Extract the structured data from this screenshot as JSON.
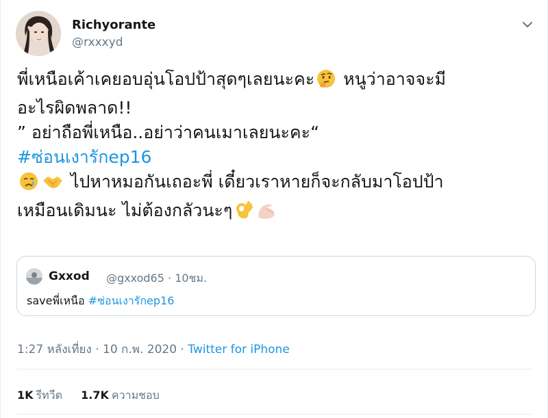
{
  "tweet": {
    "author": {
      "display_name": "Richyorante",
      "handle": "@rxxxyd",
      "avatar_icon": "user-avatar-photo"
    },
    "menu_icon": "chevron-down-icon",
    "lines": [
      {
        "text": "พี่เหนือเค้าเคยอบอุ่นโอปป้าสุดๆเลยนะคะ",
        "emoji": "thinking-face-emoji",
        "after": " หนูว่าอาจจะมี"
      },
      {
        "text": "อะไรผิดพลาด!!"
      },
      {
        "text": "” อย่าถือพี่เหนือ..อย่าว่าคนเมาเลยนะคะ“"
      },
      {
        "hashtag": "#ซ่อนเงารักep16"
      },
      {
        "text": " ไปหาหมอกันเถอะพี่ เดี๋ยวเราหายก็จะกลับมาโอปป้า"
      },
      {
        "text": "เหมือนเดิมนะ ไม่ต้องกลัวนะๆ"
      }
    ],
    "emojis": {
      "thinking": "thinking-face-emoji",
      "crying": "crying-face-emoji",
      "handshake": "handshake-emoji",
      "ok_hand": "ok-hand-emoji",
      "flexed_biceps": "flexed-biceps-emoji"
    }
  },
  "quote": {
    "display_name": "Gxxod",
    "handle": "@gxxod65",
    "separator": "·",
    "time": "10ชม.",
    "text_prefix": "saveพี่เหนือ ",
    "hashtag": "#ซ่อนเงารักep16"
  },
  "meta": {
    "time": "1:27 หลังเที่ยง",
    "separator1": " · ",
    "date": "10 ก.พ. 2020",
    "separator2": " · ",
    "source": "Twitter for iPhone"
  },
  "stats": {
    "retweets_count": "1K",
    "retweets_label": "รีทวีต",
    "likes_count": "1.7K",
    "likes_label": "ความชอบ"
  },
  "colors": {
    "link": "#1b95e0",
    "secondary_text": "#657786",
    "border": "#ccd6dd"
  }
}
